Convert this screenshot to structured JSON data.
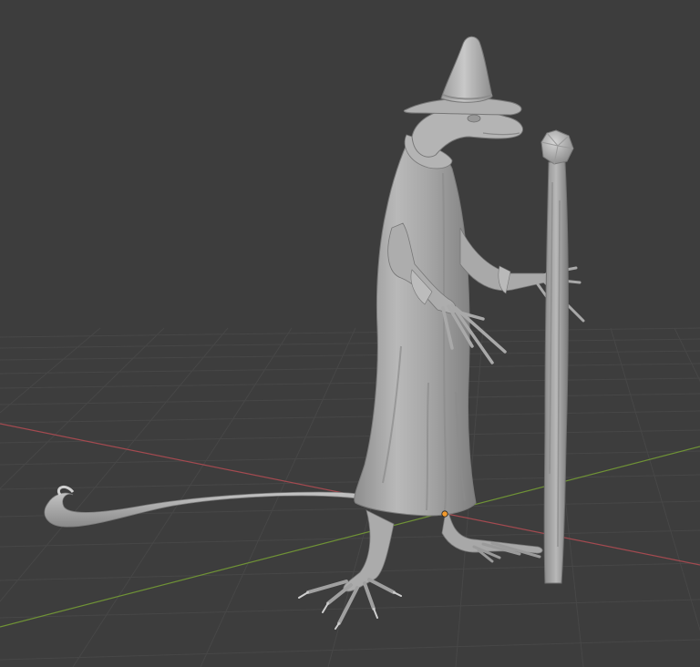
{
  "viewport": {
    "background": "#3d3d3d",
    "grid_color": "#474747",
    "x_axis_color": "#a34a50",
    "y_axis_color": "#6f9236",
    "origin_color": "#f29a2e",
    "model_color": "#a3a3a3",
    "model_highlight": "#c6c6c6",
    "model_shadow": "#6e6e6e"
  },
  "scene": {
    "object": "lizard-wizard-sculpt",
    "parts": [
      "wizard-hat",
      "lizard-head",
      "robe",
      "left-arm",
      "right-arm",
      "tail",
      "left-foot",
      "right-foot",
      "wooden-staff",
      "staff-crystal"
    ]
  }
}
